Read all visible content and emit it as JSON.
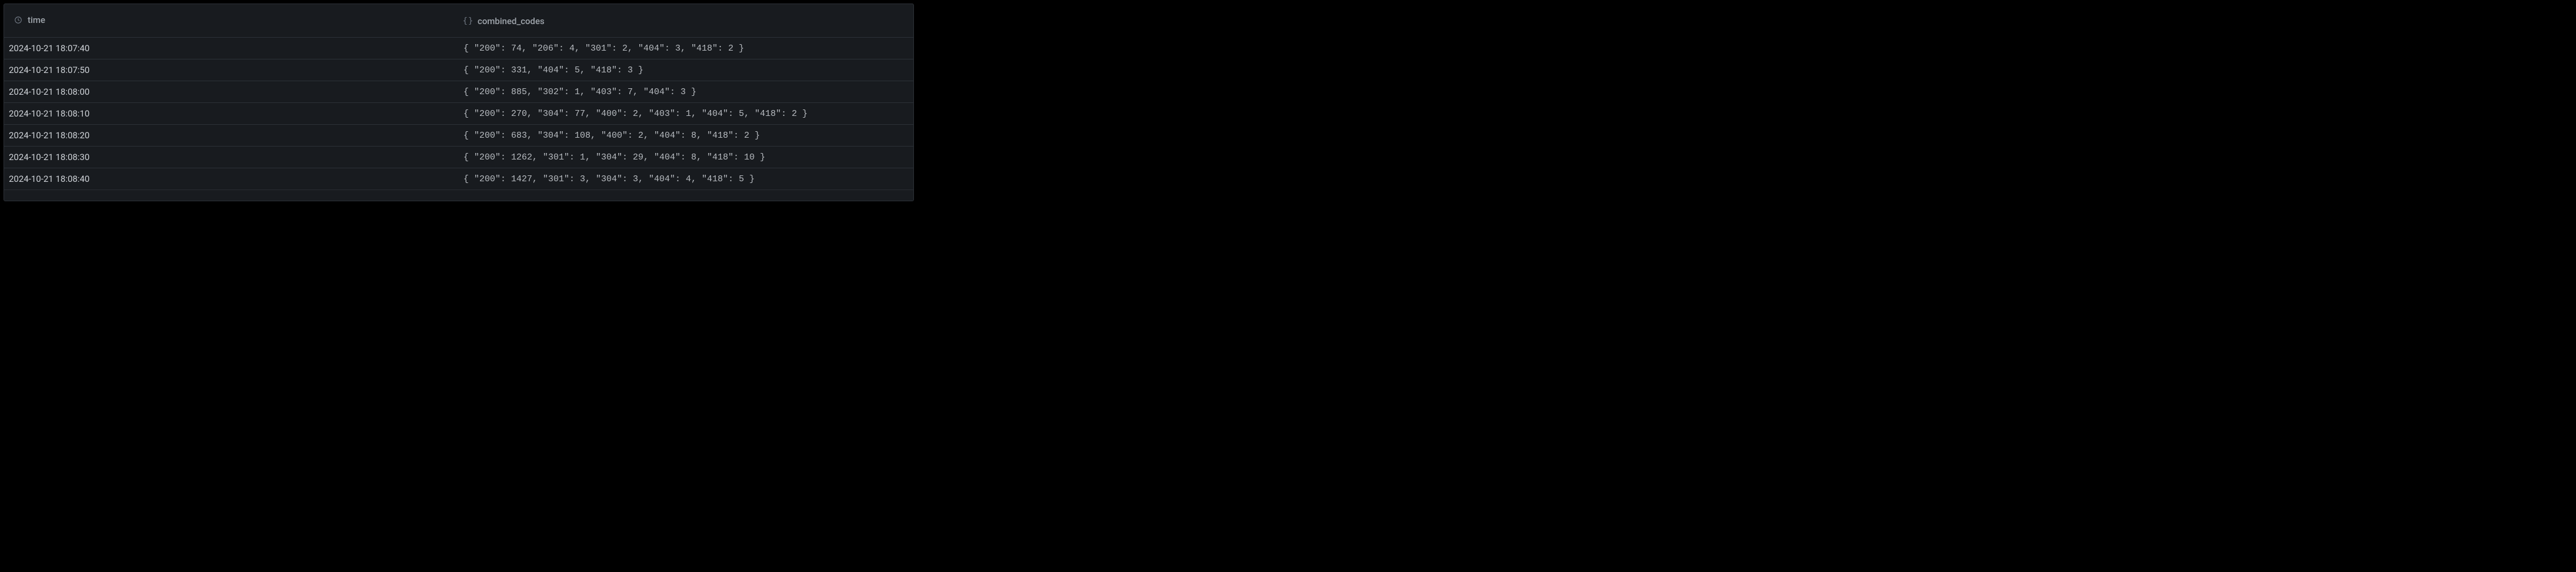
{
  "columns": {
    "time": {
      "label": "time"
    },
    "codes": {
      "label": "combined_codes"
    }
  },
  "rows": [
    {
      "time": "2024-10-21 18:07:40",
      "codes": "{ \"200\": 74, \"206\": 4, \"301\": 2, \"404\": 3, \"418\": 2 }"
    },
    {
      "time": "2024-10-21 18:07:50",
      "codes": "{ \"200\": 331, \"404\": 5, \"418\": 3 }"
    },
    {
      "time": "2024-10-21 18:08:00",
      "codes": "{ \"200\": 885, \"302\": 1, \"403\": 7, \"404\": 3 }"
    },
    {
      "time": "2024-10-21 18:08:10",
      "codes": "{ \"200\": 270, \"304\": 77, \"400\": 2, \"403\": 1, \"404\": 5, \"418\": 2 }"
    },
    {
      "time": "2024-10-21 18:08:20",
      "codes": "{ \"200\": 683, \"304\": 108, \"400\": 2, \"404\": 8, \"418\": 2 }"
    },
    {
      "time": "2024-10-21 18:08:30",
      "codes": "{ \"200\": 1262, \"301\": 1, \"304\": 29, \"404\": 8, \"418\": 10 }"
    },
    {
      "time": "2024-10-21 18:08:40",
      "codes": "{ \"200\": 1427, \"301\": 3, \"304\": 3, \"404\": 4, \"418\": 5 }"
    }
  ]
}
